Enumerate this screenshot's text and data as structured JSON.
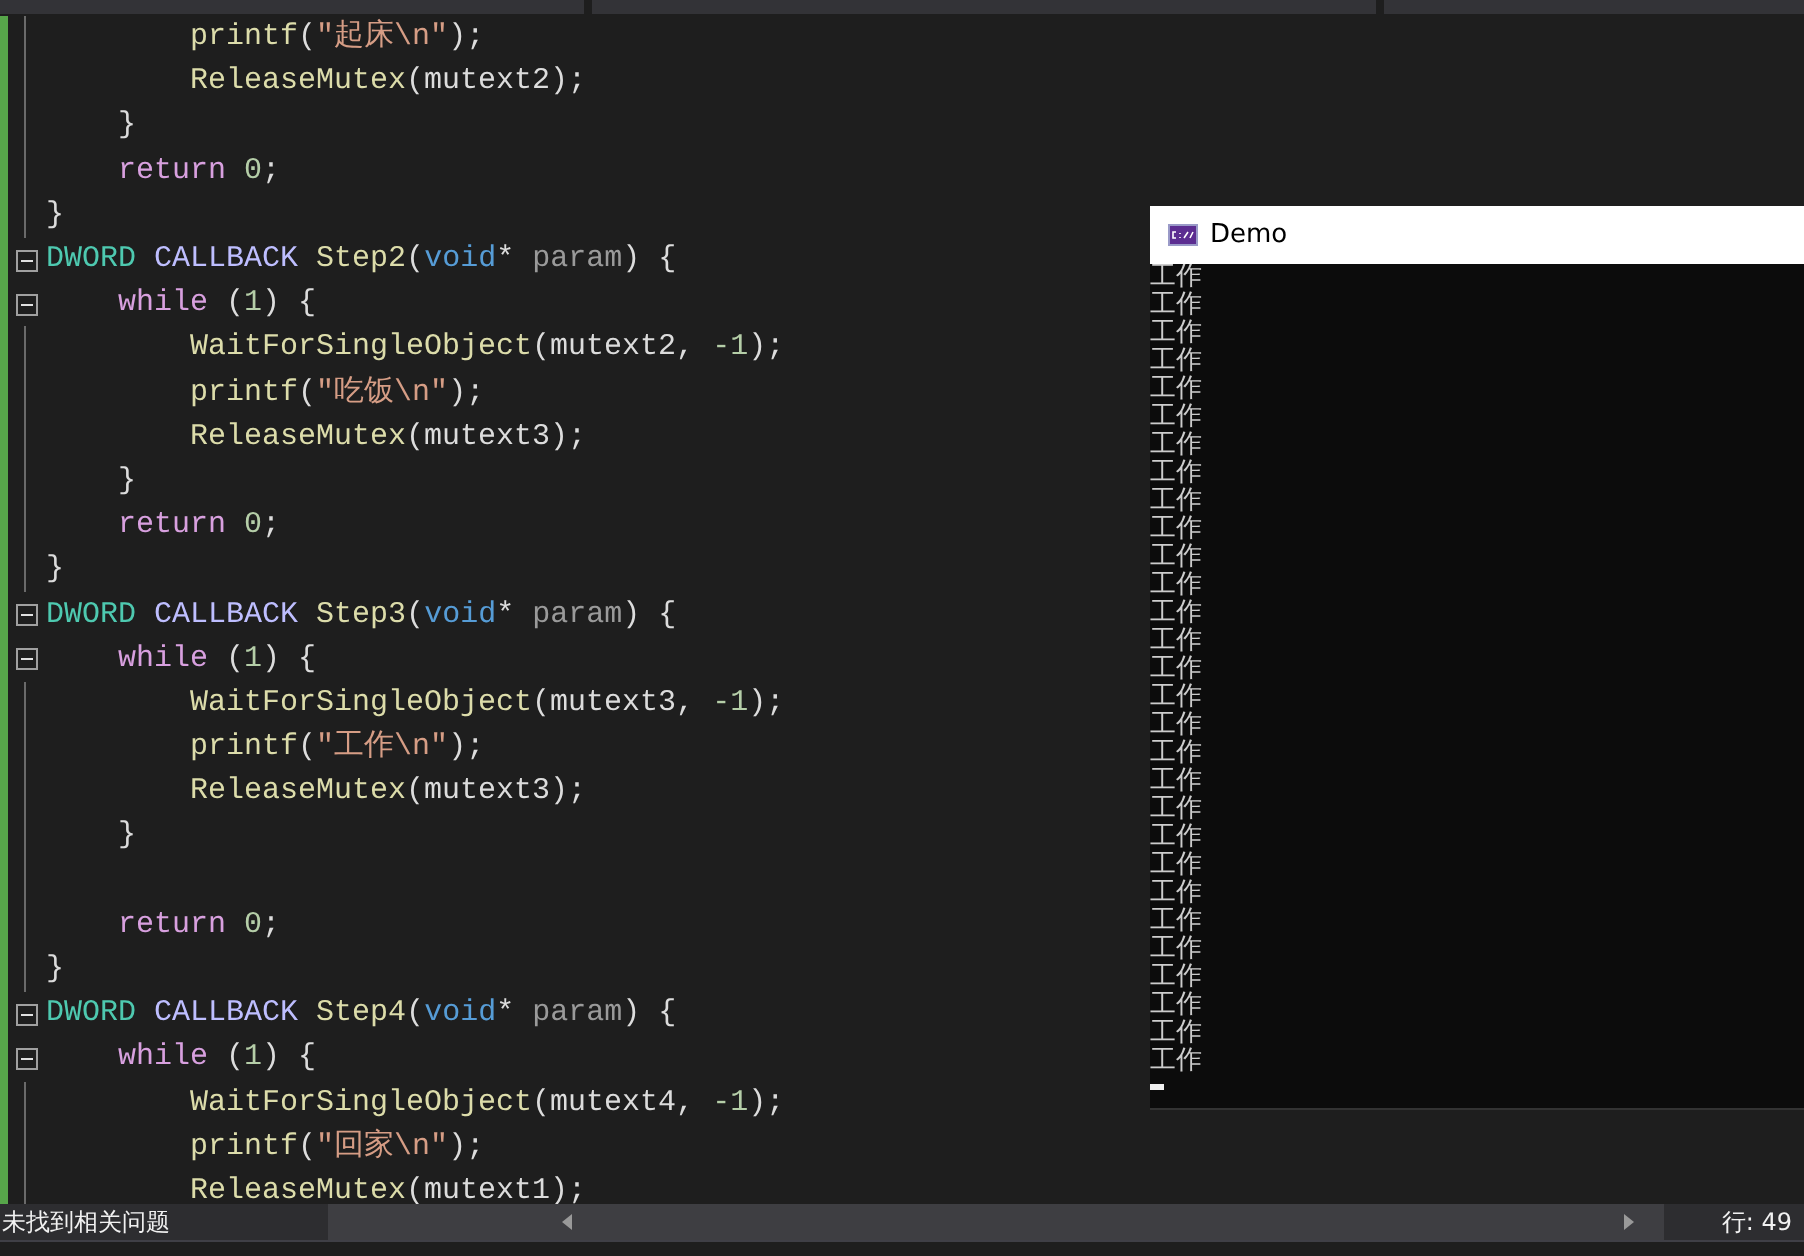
{
  "editor": {
    "lines": [
      {
        "kind": "line",
        "tokens": [
          {
            "text": "        printf",
            "kind": "func"
          },
          {
            "text": "(",
            "kind": "plain"
          },
          {
            "text": "\"起床\\n\"",
            "kind": "string"
          },
          {
            "text": ");",
            "kind": "plain"
          }
        ]
      },
      {
        "kind": "line",
        "tokens": [
          {
            "text": "        ReleaseMutex",
            "kind": "func"
          },
          {
            "text": "(mutext2);",
            "kind": "plain"
          }
        ]
      },
      {
        "kind": "line",
        "tokens": [
          {
            "text": "    }",
            "kind": "plain"
          }
        ]
      },
      {
        "kind": "line",
        "tokens": [
          {
            "text": "    return ",
            "kind": "keyword"
          },
          {
            "text": "0",
            "kind": "number"
          },
          {
            "text": ";",
            "kind": "plain"
          }
        ]
      },
      {
        "kind": "line",
        "tokens": [
          {
            "text": "}",
            "kind": "plain"
          }
        ]
      },
      {
        "kind": "fold",
        "tokens": [
          {
            "text": "DWORD ",
            "kind": "type"
          },
          {
            "text": "CALLBACK ",
            "kind": "macro"
          },
          {
            "text": "Step2",
            "kind": "func"
          },
          {
            "text": "(",
            "kind": "plain"
          },
          {
            "text": "void",
            "kind": "keyword2"
          },
          {
            "text": "* ",
            "kind": "plain"
          },
          {
            "text": "param",
            "kind": "param"
          },
          {
            "text": ") {",
            "kind": "plain"
          }
        ]
      },
      {
        "kind": "fold",
        "tokens": [
          {
            "text": "    while",
            "kind": "keyword"
          },
          {
            "text": " (",
            "kind": "plain"
          },
          {
            "text": "1",
            "kind": "number"
          },
          {
            "text": ") {",
            "kind": "plain"
          }
        ]
      },
      {
        "kind": "line",
        "tokens": [
          {
            "text": "        WaitForSingleObject",
            "kind": "func"
          },
          {
            "text": "(mutext2, ",
            "kind": "plain"
          },
          {
            "text": "-1",
            "kind": "number"
          },
          {
            "text": ");",
            "kind": "plain"
          }
        ]
      },
      {
        "kind": "line",
        "tokens": [
          {
            "text": "        printf",
            "kind": "func"
          },
          {
            "text": "(",
            "kind": "plain"
          },
          {
            "text": "\"吃饭\\n\"",
            "kind": "string"
          },
          {
            "text": ");",
            "kind": "plain"
          }
        ]
      },
      {
        "kind": "line",
        "tokens": [
          {
            "text": "        ReleaseMutex",
            "kind": "func"
          },
          {
            "text": "(mutext3);",
            "kind": "plain"
          }
        ]
      },
      {
        "kind": "line",
        "tokens": [
          {
            "text": "    }",
            "kind": "plain"
          }
        ]
      },
      {
        "kind": "line",
        "tokens": [
          {
            "text": "    return ",
            "kind": "keyword"
          },
          {
            "text": "0",
            "kind": "number"
          },
          {
            "text": ";",
            "kind": "plain"
          }
        ]
      },
      {
        "kind": "line",
        "tokens": [
          {
            "text": "}",
            "kind": "plain"
          }
        ]
      },
      {
        "kind": "fold",
        "tokens": [
          {
            "text": "DWORD ",
            "kind": "type"
          },
          {
            "text": "CALLBACK ",
            "kind": "macro"
          },
          {
            "text": "Step3",
            "kind": "func"
          },
          {
            "text": "(",
            "kind": "plain"
          },
          {
            "text": "void",
            "kind": "keyword2"
          },
          {
            "text": "* ",
            "kind": "plain"
          },
          {
            "text": "param",
            "kind": "param"
          },
          {
            "text": ") {",
            "kind": "plain"
          }
        ]
      },
      {
        "kind": "fold",
        "tokens": [
          {
            "text": "    while",
            "kind": "keyword"
          },
          {
            "text": " (",
            "kind": "plain"
          },
          {
            "text": "1",
            "kind": "number"
          },
          {
            "text": ") {",
            "kind": "plain"
          }
        ]
      },
      {
        "kind": "line",
        "tokens": [
          {
            "text": "        WaitForSingleObject",
            "kind": "func"
          },
          {
            "text": "(mutext3, ",
            "kind": "plain"
          },
          {
            "text": "-1",
            "kind": "number"
          },
          {
            "text": ");",
            "kind": "plain"
          }
        ]
      },
      {
        "kind": "line",
        "tokens": [
          {
            "text": "        printf",
            "kind": "func"
          },
          {
            "text": "(",
            "kind": "plain"
          },
          {
            "text": "\"工作\\n\"",
            "kind": "string"
          },
          {
            "text": ");",
            "kind": "plain"
          }
        ]
      },
      {
        "kind": "line",
        "tokens": [
          {
            "text": "        ReleaseMutex",
            "kind": "func"
          },
          {
            "text": "(mutext3);",
            "kind": "plain"
          }
        ]
      },
      {
        "kind": "line",
        "tokens": [
          {
            "text": "    }",
            "kind": "plain"
          }
        ]
      },
      {
        "kind": "line"
      },
      {
        "kind": "line",
        "tokens": [
          {
            "text": "    return ",
            "kind": "keyword"
          },
          {
            "text": "0",
            "kind": "number"
          },
          {
            "text": ";",
            "kind": "plain"
          }
        ]
      },
      {
        "kind": "line",
        "tokens": [
          {
            "text": "}",
            "kind": "plain"
          }
        ]
      },
      {
        "kind": "fold",
        "tokens": [
          {
            "text": "DWORD ",
            "kind": "type"
          },
          {
            "text": "CALLBACK ",
            "kind": "macro"
          },
          {
            "text": "Step4",
            "kind": "func"
          },
          {
            "text": "(",
            "kind": "plain"
          },
          {
            "text": "void",
            "kind": "keyword2"
          },
          {
            "text": "* ",
            "kind": "plain"
          },
          {
            "text": "param",
            "kind": "param"
          },
          {
            "text": ") {",
            "kind": "plain"
          }
        ]
      },
      {
        "kind": "fold",
        "tokens": [
          {
            "text": "    while",
            "kind": "keyword"
          },
          {
            "text": " (",
            "kind": "plain"
          },
          {
            "text": "1",
            "kind": "number"
          },
          {
            "text": ") {",
            "kind": "plain"
          }
        ]
      },
      {
        "kind": "line",
        "tokens": [
          {
            "text": "        WaitForSingleObject",
            "kind": "func"
          },
          {
            "text": "(mutext4, ",
            "kind": "plain"
          },
          {
            "text": "-1",
            "kind": "number"
          },
          {
            "text": ");",
            "kind": "plain"
          }
        ]
      },
      {
        "kind": "line",
        "tokens": [
          {
            "text": "        printf",
            "kind": "func"
          },
          {
            "text": "(",
            "kind": "plain"
          },
          {
            "text": "\"回家\\n\"",
            "kind": "string"
          },
          {
            "text": ");",
            "kind": "plain"
          }
        ]
      },
      {
        "kind": "line",
        "tokens": [
          {
            "text": "        ReleaseMutex",
            "kind": "func"
          },
          {
            "text": "(mutext1);",
            "kind": "plain"
          }
        ]
      }
    ]
  },
  "console": {
    "title": "Demo",
    "lines": [
      "工作",
      "工作",
      "工作",
      "工作",
      "工作",
      "工作",
      "工作",
      "工作",
      "工作",
      "工作",
      "工作",
      "工作",
      "工作",
      "工作",
      "工作",
      "工作",
      "工作",
      "工作",
      "工作",
      "工作",
      "工作",
      "工作",
      "工作",
      "工作",
      "工作",
      "工作",
      "工作",
      "工作",
      "工作"
    ]
  },
  "status_bar": {
    "message": "未找到相关问题",
    "line_info": "行: 49"
  }
}
